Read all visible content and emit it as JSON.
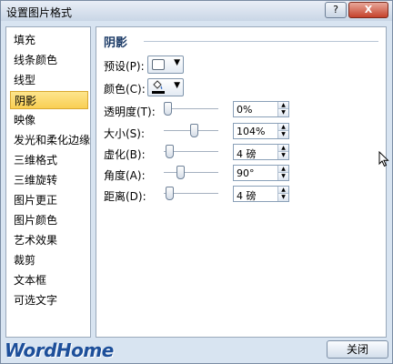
{
  "window": {
    "title": "设置图片格式",
    "help_label": "?",
    "close_label": "X"
  },
  "sidebar": {
    "items": [
      {
        "label": "填充"
      },
      {
        "label": "线条颜色"
      },
      {
        "label": "线型"
      },
      {
        "label": "阴影",
        "selected": true
      },
      {
        "label": "映像"
      },
      {
        "label": "发光和柔化边缘"
      },
      {
        "label": "三维格式"
      },
      {
        "label": "三维旋转"
      },
      {
        "label": "图片更正"
      },
      {
        "label": "图片颜色"
      },
      {
        "label": "艺术效果"
      },
      {
        "label": "裁剪"
      },
      {
        "label": "文本框"
      },
      {
        "label": "可选文字"
      }
    ]
  },
  "shadow": {
    "section_title": "阴影",
    "preset_label": "预设(P):",
    "color_label": "颜色(C):",
    "rows": [
      {
        "label": "透明度(T):",
        "value": "0%",
        "level": 0.0
      },
      {
        "label": "大小(S):",
        "value": "104%",
        "level": 0.52
      },
      {
        "label": "虚化(B):",
        "value": "4 磅",
        "level": 0.04
      },
      {
        "label": "角度(A):",
        "value": "90°",
        "level": 0.25
      },
      {
        "label": "距离(D):",
        "value": "4 磅",
        "level": 0.04
      }
    ]
  },
  "footer": {
    "logo_text": "WordHome",
    "close_button_label": "关闭"
  },
  "colors": {
    "selected_bg": "#f9cf53",
    "section_title": "#1b3a66",
    "dialog_bg": "#d8e4f1"
  }
}
